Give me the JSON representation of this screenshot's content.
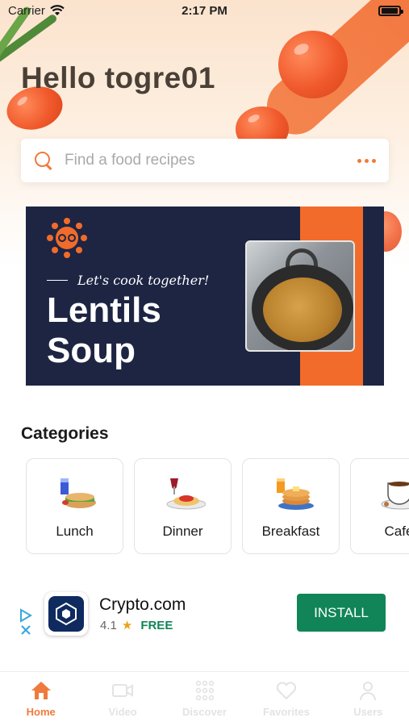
{
  "status_bar": {
    "carrier": "Carrier",
    "time": "2:17 PM"
  },
  "header": {
    "greeting": "Hello togre01"
  },
  "search": {
    "placeholder": "Find a food recipes"
  },
  "banner": {
    "tagline": "Let's cook together!",
    "title_line1": "Lentils",
    "title_line2": "Soup",
    "accent_color": "#f26b2a",
    "background_color": "#1d2543"
  },
  "categories": {
    "title": "Categories",
    "items": [
      {
        "label": "Lunch",
        "icon": "sandwich-drink-icon"
      },
      {
        "label": "Dinner",
        "icon": "spaghetti-wine-icon"
      },
      {
        "label": "Breakfast",
        "icon": "pancakes-juice-icon"
      },
      {
        "label": "Cafe",
        "icon": "coffee-cup-icon"
      }
    ]
  },
  "ad": {
    "app_name": "Crypto.com",
    "rating": "4.1",
    "price": "FREE",
    "install_label": "INSTALL"
  },
  "tabbar": {
    "active_color": "#f07a3d",
    "items": [
      {
        "label": "Home",
        "icon": "home-icon",
        "active": true
      },
      {
        "label": "Video",
        "icon": "video-icon",
        "active": false
      },
      {
        "label": "Discover",
        "icon": "grid-dots-icon",
        "active": false
      },
      {
        "label": "Favorites",
        "icon": "heart-icon",
        "active": false
      },
      {
        "label": "Users",
        "icon": "user-icon",
        "active": false
      }
    ]
  }
}
